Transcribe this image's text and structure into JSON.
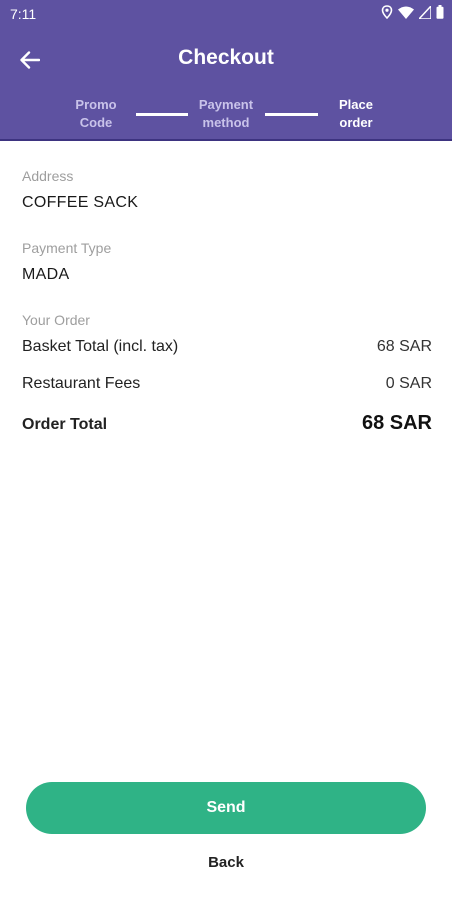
{
  "status_bar": {
    "time": "7:11",
    "icons": [
      "location-icon",
      "wifi-icon",
      "signal-icon",
      "battery-icon"
    ]
  },
  "header": {
    "title": "Checkout",
    "back_icon": "arrow-left-icon",
    "steps": [
      {
        "line1": "Promo",
        "line2": "Code",
        "active": false
      },
      {
        "line1": "Payment",
        "line2": "method",
        "active": false
      },
      {
        "line1": "Place",
        "line2": "order",
        "active": true
      }
    ]
  },
  "details": {
    "address_label": "Address",
    "address_value": "COFFEE SACK",
    "payment_label": "Payment Type",
    "payment_value": "MADA",
    "order_label": "Your Order",
    "rows": [
      {
        "label": "Basket Total (incl. tax)",
        "amount": "68 SAR"
      },
      {
        "label": "Restaurant Fees",
        "amount": "0 SAR"
      },
      {
        "label": "Order Total",
        "amount": "68 SAR"
      }
    ]
  },
  "actions": {
    "send_label": "Send",
    "back_label": "Back"
  },
  "colors": {
    "header_bg": "#5e52a1",
    "send_bg": "#2fb386"
  }
}
